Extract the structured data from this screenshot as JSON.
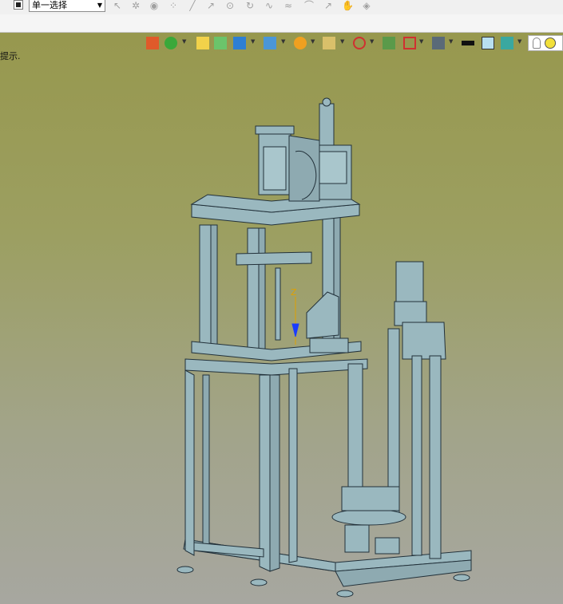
{
  "toolbar": {
    "selection_mode": "单一选择",
    "hint_text": "提示."
  },
  "toolbar_icons": [
    "stop-icon",
    "select-cursor-icon",
    "gear-icon",
    "motion-icon",
    "point-icon",
    "line-icon",
    "arrow-icon",
    "circle-icon",
    "rotate-icon",
    "curve-icon",
    "wave-icon",
    "arc-icon",
    "arrow-tool-icon",
    "hand-icon",
    "layers-icon"
  ],
  "view_toolbar_icons": [
    "import-icon",
    "render-icon",
    "highlight-icon",
    "box-icon",
    "cube-view-icon",
    "section-icon",
    "orange-sphere-icon",
    "zoom-icon",
    "axis-icon",
    "frame-icon",
    "dimension-icon",
    "monitor-icon",
    "black-rect-icon",
    "cyan-square-icon",
    "layer-stack-icon",
    "bulb-icon",
    "light-icon"
  ],
  "colors": {
    "viewport_top": "#97984e",
    "viewport_bottom": "#a7a7a0",
    "model_fill": "#9ab8bf",
    "model_stroke": "#22313a"
  }
}
